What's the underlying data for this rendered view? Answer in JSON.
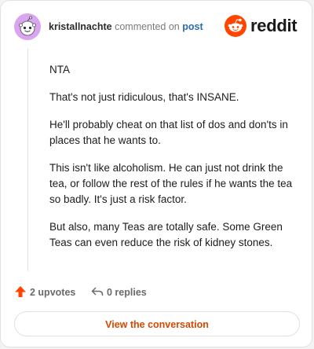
{
  "header": {
    "username": "kristallnachte",
    "action_text": "commented on",
    "post_link": "post",
    "brand": "reddit"
  },
  "comment": {
    "paragraphs": [
      "NTA",
      "That's not just ridiculous, that's INSANE.",
      "He'll probably cheat on that list of dos and don'ts in places that he wants to.",
      "This isn't like alcoholism. He can just not drink the tea, or follow the rest of the rules if he wants the tea so badly. It's just a risk factor.",
      "But also, many Teas are totally safe. Some Green Teas can even reduce the risk of kidney stones."
    ]
  },
  "actions": {
    "upvotes": "2 upvotes",
    "replies": "0 replies"
  },
  "cta": {
    "label": "View the conversation"
  },
  "colors": {
    "brand": "#ff4500",
    "link": "#2a6db0",
    "cta": "#d54800",
    "avatar": "#d9a4f0"
  },
  "icons": {
    "avatar": "snoo-avatar-icon",
    "logo": "reddit-snoo-icon",
    "upvote": "upvote-arrow-icon",
    "reply": "reply-arrow-icon"
  }
}
